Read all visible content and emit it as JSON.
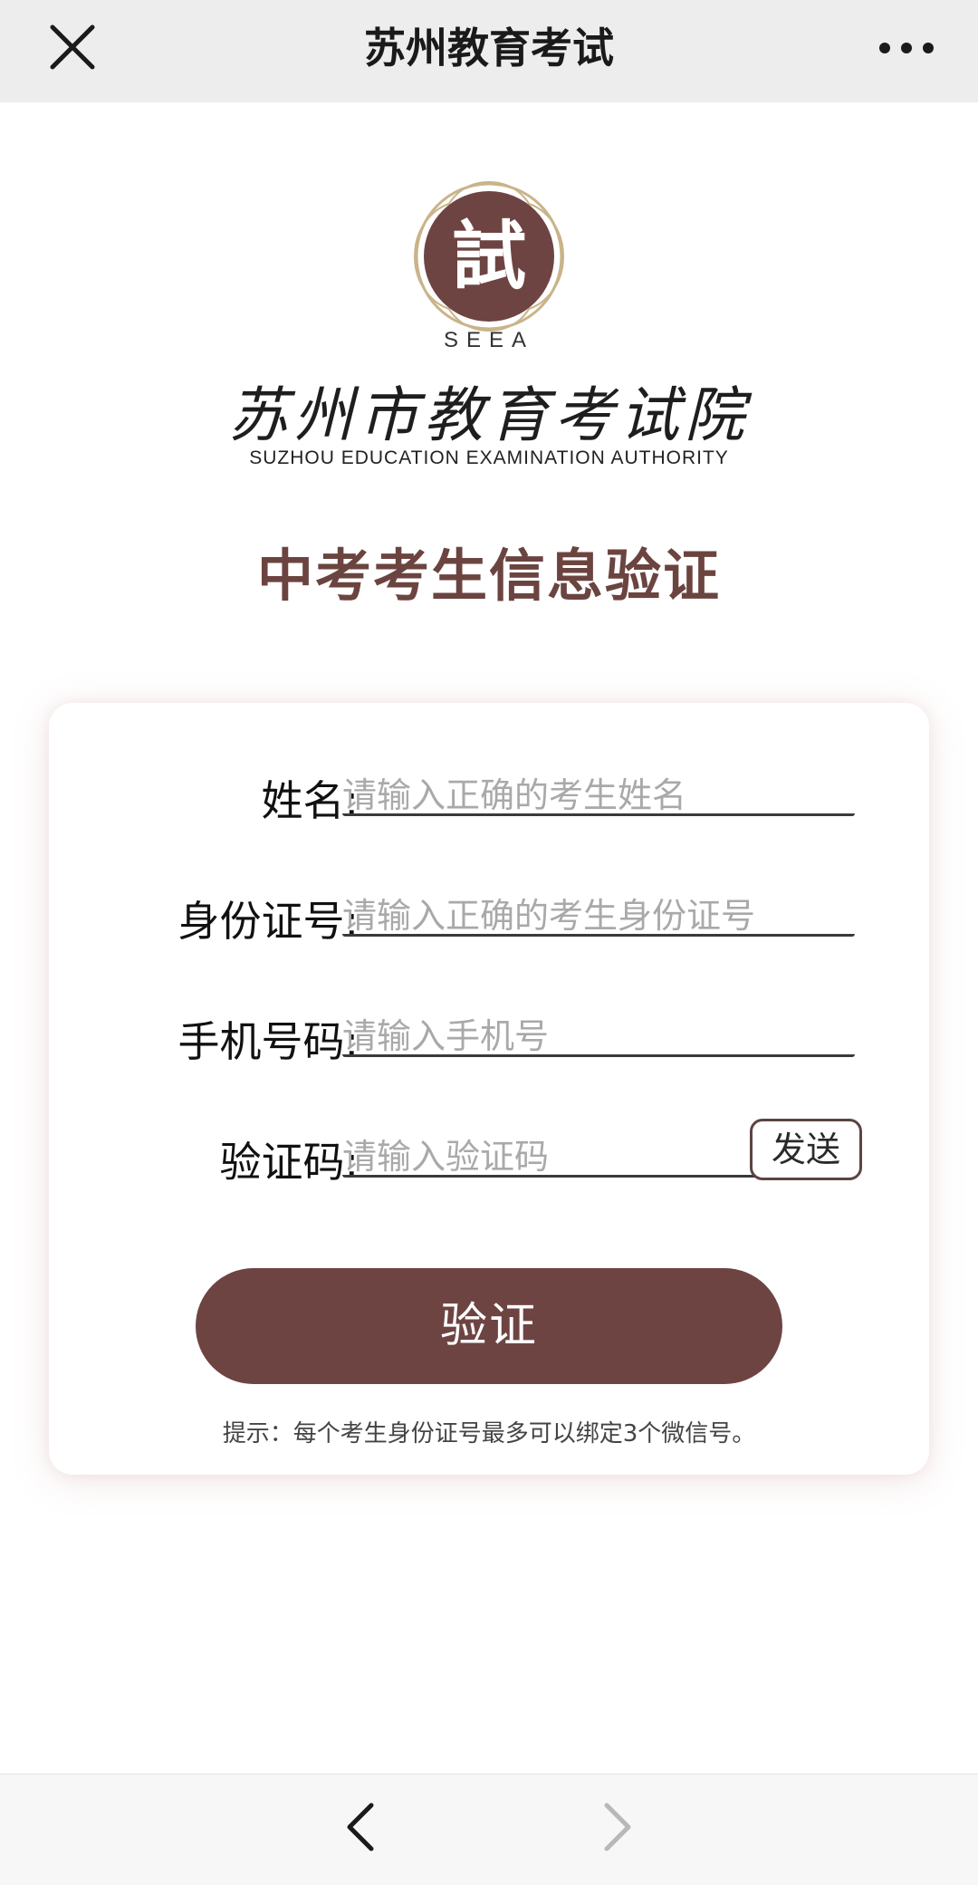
{
  "nav": {
    "title": "苏州教育考试",
    "close_icon": "close-icon",
    "more_icon": "more-horizontal-icon"
  },
  "logo": {
    "emblem_char": "試",
    "abbr": "SEEA",
    "name_cn": "苏州市教育考试院",
    "name_en": "SUZHOU EDUCATION EXAMINATION AUTHORITY",
    "emblem_color": "#6e4442",
    "emblem_ring_color": "#c9b48a"
  },
  "page": {
    "title": "中考考生信息验证",
    "title_color": "#6b4440"
  },
  "form": {
    "name": {
      "label": "姓名:",
      "placeholder": "请输入正确的考生姓名",
      "value": ""
    },
    "id_number": {
      "label": "身份证号:",
      "placeholder": "请输入正确的考生身份证号",
      "value": ""
    },
    "phone": {
      "label": "手机号码:",
      "placeholder": "请输入手机号",
      "value": ""
    },
    "code": {
      "label": "验证码:",
      "placeholder": "请输入验证码",
      "value": "",
      "send_label": "发送"
    },
    "submit_label": "验证",
    "submit_color": "#6e4442",
    "tip": "提示：每个考生身份证号最多可以绑定3个微信号。"
  },
  "bottom_nav": {
    "back_icon": "chevron-left-icon",
    "forward_icon": "chevron-right-icon"
  }
}
